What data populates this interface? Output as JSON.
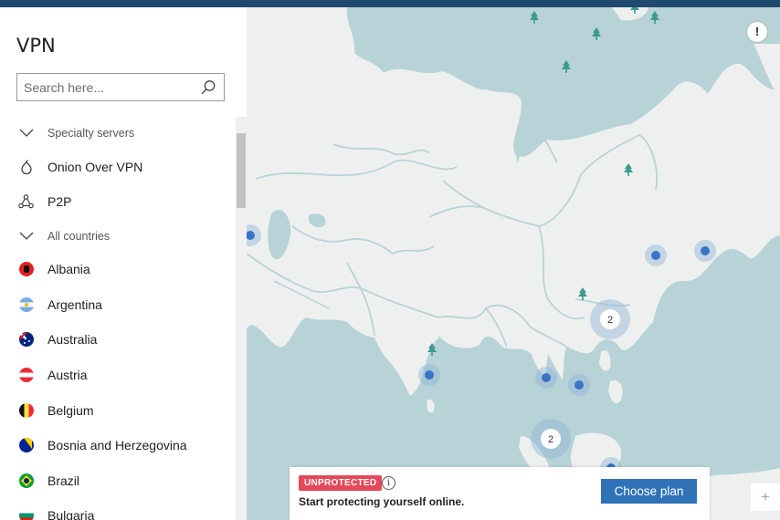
{
  "sidebar": {
    "title": "VPN",
    "search_placeholder": "Search here...",
    "items": [
      {
        "type": "section",
        "label": "Specialty servers",
        "icon": "chevron-down-icon"
      },
      {
        "type": "item",
        "label": "Onion Over VPN",
        "icon": "onion-icon"
      },
      {
        "type": "item",
        "label": "P2P",
        "icon": "p2p-icon"
      },
      {
        "type": "section",
        "label": "All countries",
        "icon": "chevron-down-icon"
      },
      {
        "type": "country",
        "label": "Albania",
        "icon": "flag-albania-icon"
      },
      {
        "type": "country",
        "label": "Argentina",
        "icon": "flag-argentina-icon"
      },
      {
        "type": "country",
        "label": "Australia",
        "icon": "flag-australia-icon"
      },
      {
        "type": "country",
        "label": "Austria",
        "icon": "flag-austria-icon"
      },
      {
        "type": "country",
        "label": "Belgium",
        "icon": "flag-belgium-icon"
      },
      {
        "type": "country",
        "label": "Bosnia and Herzegovina",
        "icon": "flag-bosnia-icon"
      },
      {
        "type": "country",
        "label": "Brazil",
        "icon": "flag-brazil-icon"
      },
      {
        "type": "country",
        "label": "Bulgaria",
        "icon": "flag-bulgaria-icon"
      }
    ]
  },
  "map": {
    "alert_label": "!",
    "cluster_counts": [
      "2",
      "2"
    ],
    "zoom_in_label": "+"
  },
  "banner": {
    "status_badge": "UNPROTECTED",
    "info_label": "i",
    "message": "Start protecting yourself online.",
    "cta_label": "Choose plan"
  },
  "colors": {
    "topbar": "#1f4a6e",
    "sea": "#b8d3d8",
    "land": "#eef0ef",
    "border": "#b8d3d8",
    "server_dot": "#3a74c4",
    "tree": "#3c9a8e",
    "badge": "#e4485a",
    "cta": "#2f72b8"
  }
}
